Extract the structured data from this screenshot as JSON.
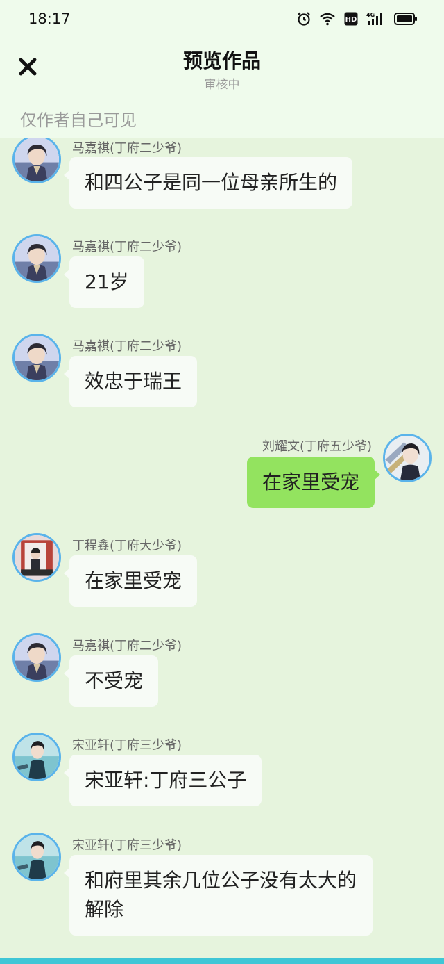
{
  "status_bar": {
    "time": "18:17",
    "icons": [
      "alarm-icon",
      "wifi-icon",
      "hd-icon",
      "4g-signal-icon",
      "battery-icon"
    ],
    "hd_label": "HD",
    "network_label": "4G"
  },
  "header": {
    "close_icon": "close-icon",
    "title": "预览作品",
    "subtitle": "审核中",
    "visibility_note": "仅作者自己可见"
  },
  "colors": {
    "background": "#e6f4dd",
    "header_bg": "#effbec",
    "bubble_left": "#f7fbf6",
    "bubble_right": "#93e35f",
    "avatar_ring": "#5ab3ea",
    "bottom_bar": "#3fc6d6"
  },
  "messages": [
    {
      "side": "left",
      "name": "马嘉祺(丁府二少爷)",
      "text": "和四公子是同一位母亲所生的",
      "avatar": "avatar-majiaqi"
    },
    {
      "side": "left",
      "name": "马嘉祺(丁府二少爷)",
      "text": "21岁",
      "avatar": "avatar-majiaqi"
    },
    {
      "side": "left",
      "name": "马嘉祺(丁府二少爷)",
      "text": "效忠于瑞王",
      "avatar": "avatar-majiaqi"
    },
    {
      "side": "right",
      "name": "刘耀文(丁府五少爷)",
      "text": "在家里受宠",
      "avatar": "avatar-liuyaowen"
    },
    {
      "side": "left",
      "name": "丁程鑫(丁府大少爷)",
      "text": "在家里受宠",
      "avatar": "avatar-dingchengxin"
    },
    {
      "side": "left",
      "name": "马嘉祺(丁府二少爷)",
      "text": "不受宠",
      "avatar": "avatar-majiaqi"
    },
    {
      "side": "left",
      "name": "宋亚轩(丁府三少爷)",
      "text": "宋亚轩:丁府三公子",
      "avatar": "avatar-songyaxuan"
    },
    {
      "side": "left",
      "name": "宋亚轩(丁府三少爷)",
      "text": "和府里其余几位公子没有太大的解除",
      "avatar": "avatar-songyaxuan"
    }
  ]
}
